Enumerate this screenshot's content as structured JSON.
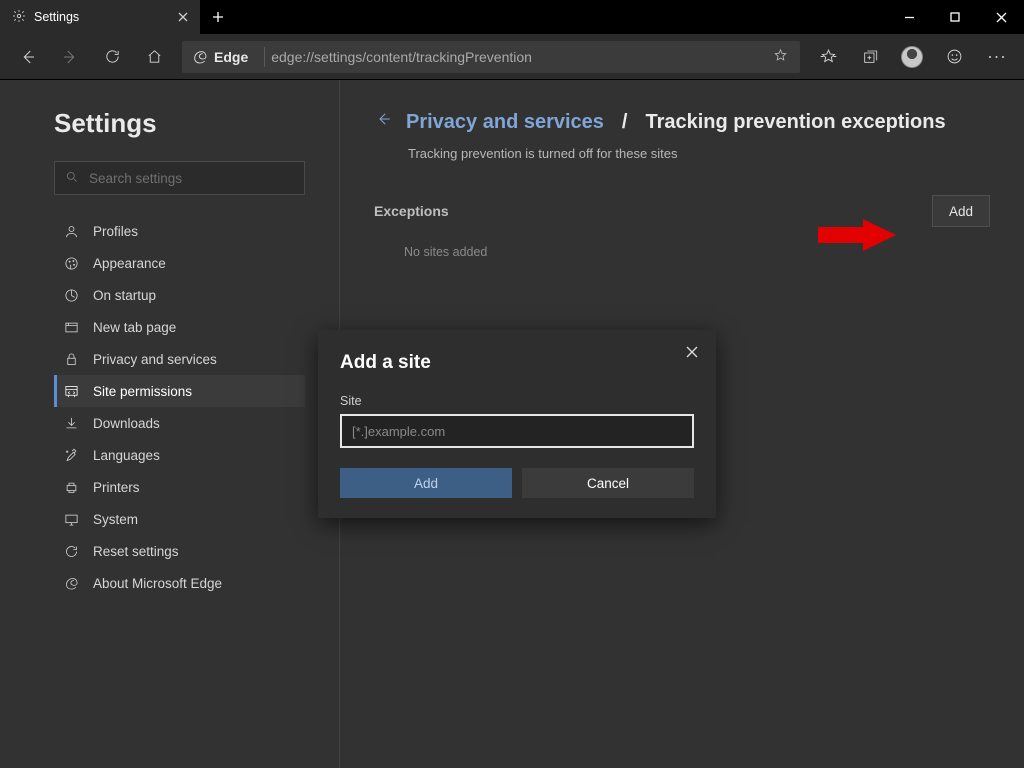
{
  "window": {
    "tab_title": "Settings",
    "new_tab": "+"
  },
  "addressbar": {
    "badge": "Edge",
    "url": "edge://settings/content/trackingPrevention"
  },
  "sidebar": {
    "title": "Settings",
    "search_placeholder": "Search settings",
    "items": [
      {
        "label": "Profiles"
      },
      {
        "label": "Appearance"
      },
      {
        "label": "On startup"
      },
      {
        "label": "New tab page"
      },
      {
        "label": "Privacy and services"
      },
      {
        "label": "Site permissions"
      },
      {
        "label": "Downloads"
      },
      {
        "label": "Languages"
      },
      {
        "label": "Printers"
      },
      {
        "label": "System"
      },
      {
        "label": "Reset settings"
      },
      {
        "label": "About Microsoft Edge"
      }
    ],
    "active_index": 5
  },
  "page": {
    "crumb_link": "Privacy and services",
    "crumb_sep": "/",
    "crumb_title": "Tracking prevention exceptions",
    "desc": "Tracking prevention is turned off for these sites",
    "exceptions_label": "Exceptions",
    "add_button": "Add",
    "empty": "No sites added"
  },
  "dialog": {
    "title": "Add a site",
    "field_label": "Site",
    "placeholder": "[*.]example.com",
    "value": "",
    "add": "Add",
    "cancel": "Cancel"
  }
}
